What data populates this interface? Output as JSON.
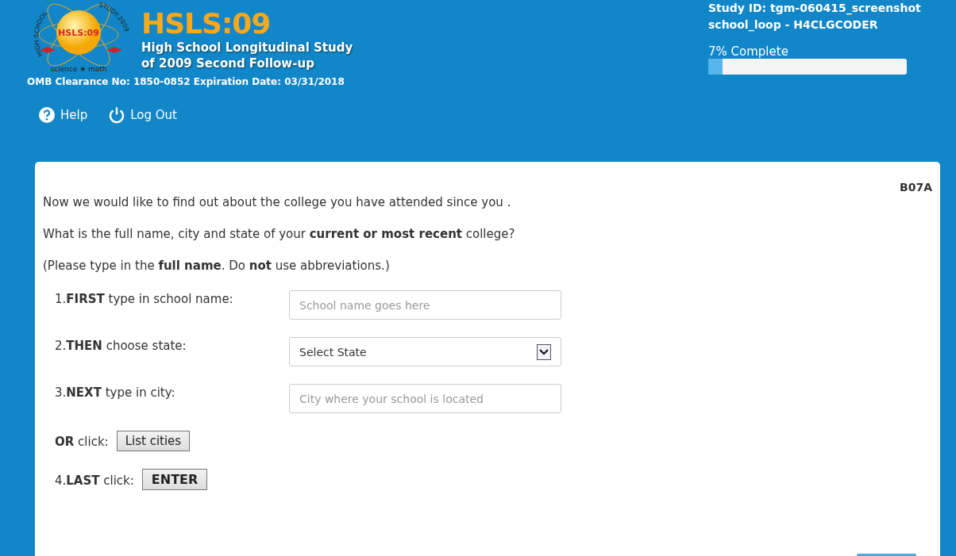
{
  "logo": {
    "badge": "HSLS:09",
    "ring_left": "HIGH SCHOOL",
    "ring_right": "STUDY:2009",
    "motto": "science ★ math"
  },
  "title": "HSLS:09",
  "subtitle": [
    "High School Longitudinal Study",
    "of 2009 Second Follow-up"
  ],
  "omb": "OMB Clearance No: 1850-0852 Expiration Date: 03/31/2018",
  "nav": [
    {
      "kind": "help",
      "label": "Help"
    },
    {
      "kind": "logout",
      "label": "Log Out"
    }
  ],
  "study": [
    "Study ID: tgm-060415_screenshot",
    "school_loop - H4CLGCODER"
  ],
  "progress": {
    "label": "7% Complete",
    "level": 0.07
  },
  "question": {
    "code": "B07A",
    "paragraphs": [
      "Now we would like to find out about the college you have attended since you .",
      "What is the full name, city and state of your **current or most recent** college?",
      "(Please type in the **full name**. Do **not** use abbreviations.)"
    ],
    "steps": [
      {
        "kind": "input",
        "label": "1.**FIRST** type in school name:",
        "placeholder": "School name goes here"
      },
      {
        "kind": "select",
        "label": "2.**THEN** choose state:",
        "value": "Select State"
      },
      {
        "kind": "input",
        "label": "3.**NEXT** type in city:",
        "placeholder": "City where your school is located"
      },
      {
        "kind": "button",
        "label": "**OR** click:",
        "button": "List cities",
        "strong": false
      },
      {
        "kind": "button",
        "label": "4.**LAST** click:",
        "button": "ENTER",
        "strong": true
      }
    ]
  }
}
